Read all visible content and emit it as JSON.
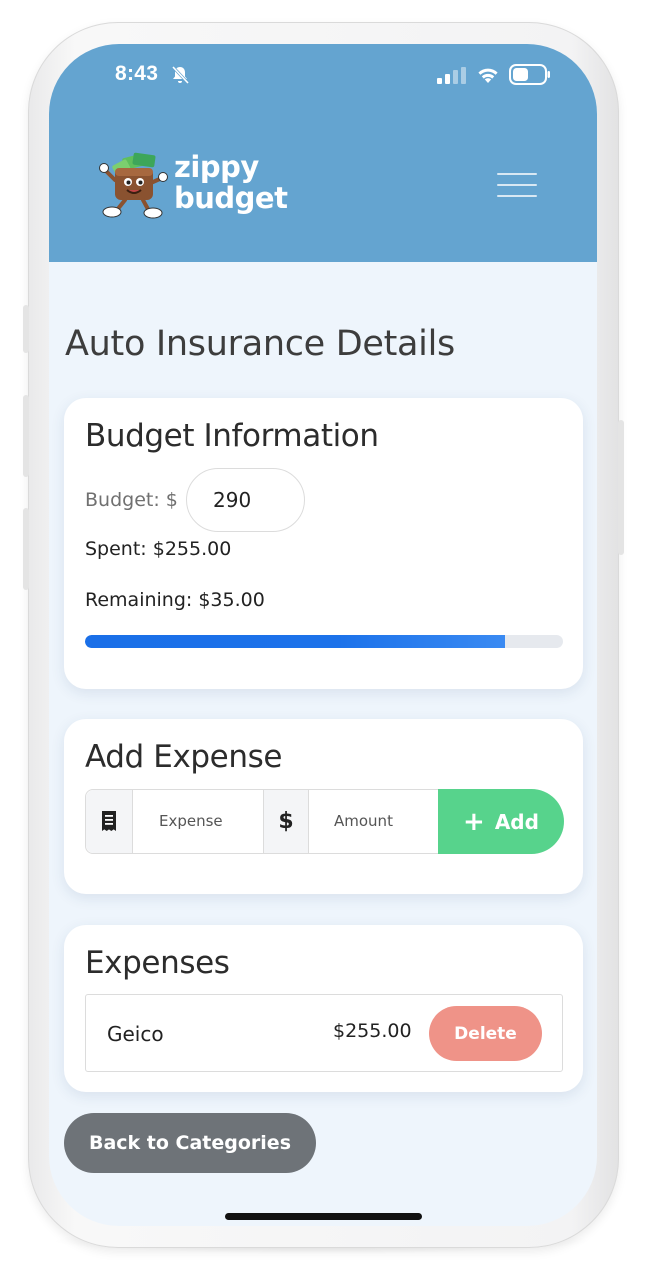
{
  "status_bar": {
    "time": "8:43",
    "icons": [
      "bell-off-icon",
      "signal-icon",
      "wifi-icon",
      "battery-icon"
    ]
  },
  "header": {
    "logo_line1": "zippy",
    "logo_line2": "budget",
    "menu_icon": "hamburger-menu-icon",
    "background_color": "#64a4d0"
  },
  "page": {
    "title": "Auto Insurance Details"
  },
  "budget_info": {
    "title": "Budget Information",
    "budget_label": "Budget: $",
    "budget_value": "290",
    "spent_text": "Spent: $255.00",
    "remaining_text": "Remaining: $35.00",
    "progress_fraction": 0.879,
    "progress_color": "#1a6fe8"
  },
  "add_expense": {
    "title": "Add Expense",
    "expense_placeholder": "Expense",
    "currency_symbol": "$",
    "amount_placeholder": "Amount",
    "add_label": "Add",
    "add_color": "#57d38c"
  },
  "expenses": {
    "title": "Expenses",
    "items": [
      {
        "name": "Geico",
        "amount": "$255.00",
        "delete_label": "Delete"
      }
    ],
    "delete_color": "#ef9388"
  },
  "footer": {
    "back_label": "Back to Categories"
  }
}
